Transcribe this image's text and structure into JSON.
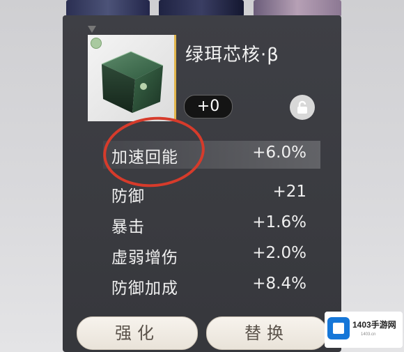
{
  "item": {
    "name": "绿珥芯核·β",
    "level": "+0",
    "icon": "green-crystal-cube-icon",
    "rarity_color": "#e1b54c"
  },
  "stats": [
    {
      "label": "加速回能",
      "value": "+6.0%",
      "highlighted": true
    },
    {
      "label": "防御",
      "value": "+21"
    },
    {
      "label": "暴击",
      "value": "+1.6%"
    },
    {
      "label": "虚弱增伤",
      "value": "+2.0%"
    },
    {
      "label": "防御加成",
      "value": "+8.4%"
    }
  ],
  "buttons": {
    "enhance": "强化",
    "replace": "替换"
  },
  "watermark": {
    "text": "1403手游网",
    "sub": "1403.cn"
  },
  "colors": {
    "panel": "#3c3d42",
    "annotation": "#d63b2b",
    "button_bg": "#f2ede5"
  }
}
